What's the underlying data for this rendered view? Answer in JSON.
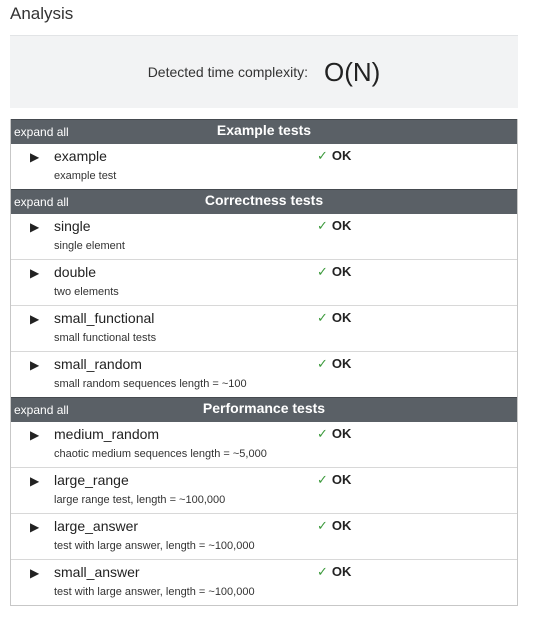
{
  "analysis": {
    "title": "Analysis",
    "complexity_label": "Detected time complexity:",
    "complexity_value": "O(N)"
  },
  "groups": [
    {
      "expand_label": "expand all",
      "title": "Example tests",
      "tests": [
        {
          "name": "example",
          "description": "example test",
          "status": "OK"
        }
      ]
    },
    {
      "expand_label": "expand all",
      "title": "Correctness tests",
      "tests": [
        {
          "name": "single",
          "description": "single element",
          "status": "OK"
        },
        {
          "name": "double",
          "description": "two elements",
          "status": "OK"
        },
        {
          "name": "small_functional",
          "description": "small functional tests",
          "status": "OK"
        },
        {
          "name": "small_random",
          "description": "small random sequences length = ~100",
          "status": "OK"
        }
      ]
    },
    {
      "expand_label": "expand all",
      "title": "Performance tests",
      "tests": [
        {
          "name": "medium_random",
          "description": "chaotic medium sequences length = ~5,000",
          "status": "OK"
        },
        {
          "name": "large_range",
          "description": "large range test, length = ~100,000",
          "status": "OK"
        },
        {
          "name": "large_answer",
          "description": "test with large answer, length = ~100,000",
          "status": "OK"
        },
        {
          "name": "small_answer",
          "description": "test with large answer, length = ~100,000",
          "status": "OK"
        }
      ]
    }
  ],
  "icons": {
    "expand_arrow": "play-triangle-icon",
    "status_check": "check-mark-icon"
  },
  "colors": {
    "header_bg": "#5a6066",
    "check": "#3c9a3c",
    "panel_bg": "#f2f3f4"
  }
}
